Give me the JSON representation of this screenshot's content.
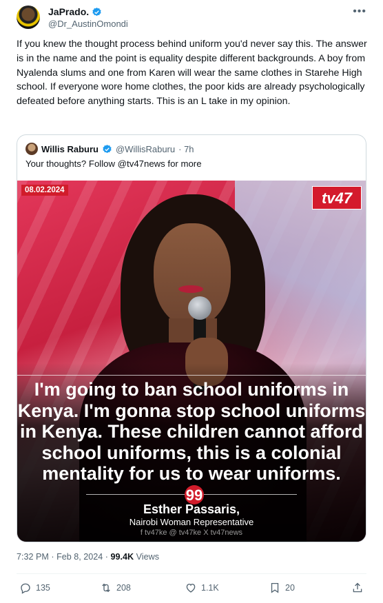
{
  "author": {
    "display_name": "JaPrado.",
    "handle": "@Dr_AustinOmondi"
  },
  "more_label": "•••",
  "tweet_text": "If you knew the thought process behind uniform you'd never say this. The answer is in the name and the point is equality despite different backgrounds. A boy from Nyalenda slums and one from Karen will wear the same clothes in Starehe High school. If everyone wore home clothes, the poor kids are already psychologically defeated before anything starts. This is an L take in my opinion.",
  "quoted": {
    "display_name": "Willis Raburu",
    "handle": "@WillisRaburu",
    "time": "· 7h",
    "text": "Your thoughts? Follow @tv47news for more",
    "media": {
      "date_badge": "08.02.2024",
      "logo": "tv47",
      "quote_lines": [
        "I'm going to ban school uniforms in",
        "Kenya. I'm gonna stop school uniforms",
        "in Kenya. These children cannot afford",
        "school uniforms, this is a colonial",
        "mentality for us to wear uniforms."
      ],
      "quote_mark": "99",
      "speaker_name": "Esther Passaris,",
      "speaker_title": "Nairobi Woman Representative",
      "socials": "f tv47ke  @ tv47ke  X tv47news"
    }
  },
  "meta": {
    "time": "7:32 PM · Feb 8, 2024 · ",
    "views_count": "99.4K",
    "views_label": " Views"
  },
  "actions": {
    "replies": "135",
    "reposts": "208",
    "likes": "1.1K",
    "bookmarks": "20"
  },
  "colors": {
    "verified": "#1d9bf0",
    "text_secondary": "#536471",
    "tv47_red": "#d11c2b"
  }
}
